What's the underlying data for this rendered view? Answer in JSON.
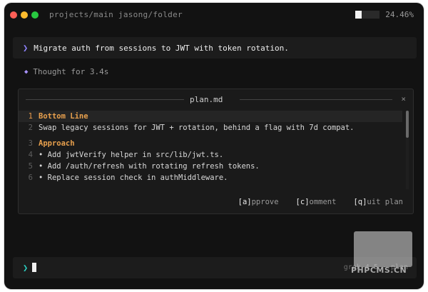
{
  "titlebar": {
    "path": "projects/main jasong/folder",
    "context_usage_fraction": 0.2446,
    "context_usage_label": "24.46%"
  },
  "prompt": {
    "chevron": "❯",
    "text": "Migrate auth from sessions to JWT with token rotation."
  },
  "thought": {
    "icon": "diamond-icon",
    "text": "Thought for 3.4s"
  },
  "plan": {
    "filename": "plan.md",
    "close": "×",
    "lines": [
      {
        "n": "1",
        "text": "Bottom Line",
        "heading": true
      },
      {
        "n": "2",
        "text": "Swap legacy sessions for JWT + rotation, behind a flag with 7d compat."
      },
      {
        "n": "3",
        "text": "Approach",
        "heading": true
      },
      {
        "n": "4",
        "text": "• Add jwtVerify helper in src/lib/jwt.ts."
      },
      {
        "n": "5",
        "text": "• Add /auth/refresh with rotating refresh tokens."
      },
      {
        "n": "6",
        "text": "• Replace session check in authMiddleware."
      }
    ],
    "actions": [
      {
        "key": "[a]",
        "rest": " pprove"
      },
      {
        "key": "[c]",
        "rest": " omment"
      },
      {
        "key": "[q]",
        "rest": " uit plan"
      }
    ]
  },
  "input": {
    "chevron": "❯",
    "model_label": "grok-4.5 · plan"
  },
  "watermark": {
    "text": "PHPCMS.CN"
  },
  "colors": {
    "background": "#121212",
    "accent_purple": "#8f83ff",
    "heading_orange": "#e8a04d",
    "input_chevron": "#2bd0c2"
  }
}
